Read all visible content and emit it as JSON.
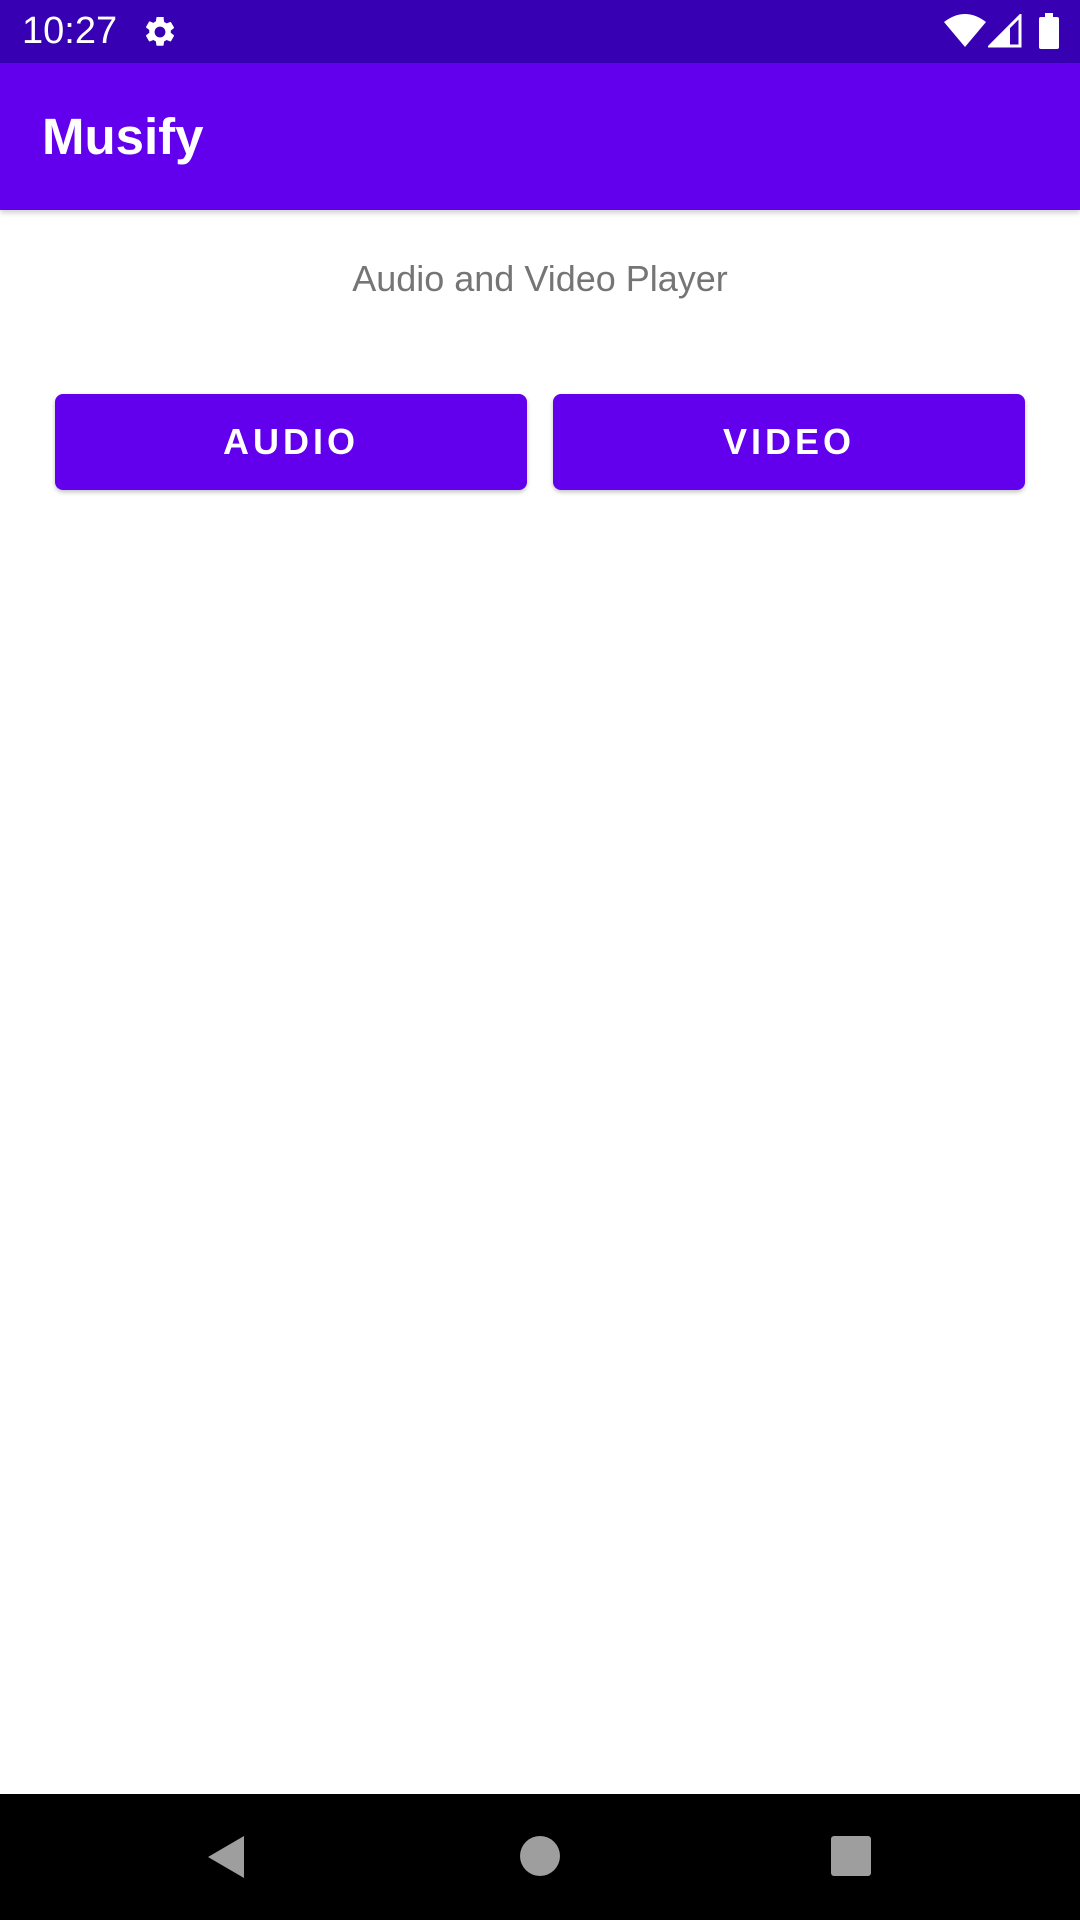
{
  "status_bar": {
    "time": "10:27",
    "icons": [
      "settings-gear-icon",
      "wifi-icon",
      "cell-signal-icon",
      "battery-icon"
    ],
    "background": "#3700b3"
  },
  "app_bar": {
    "title": "Musify",
    "background": "#6200ee"
  },
  "main": {
    "subtitle": "Audio and Video Player",
    "buttons": [
      {
        "label": "AUDIO"
      },
      {
        "label": "VIDEO"
      }
    ],
    "button_color": "#6200ee"
  },
  "nav_bar": {
    "icons": [
      "back-icon",
      "home-icon",
      "recents-icon"
    ],
    "background": "#000000"
  }
}
